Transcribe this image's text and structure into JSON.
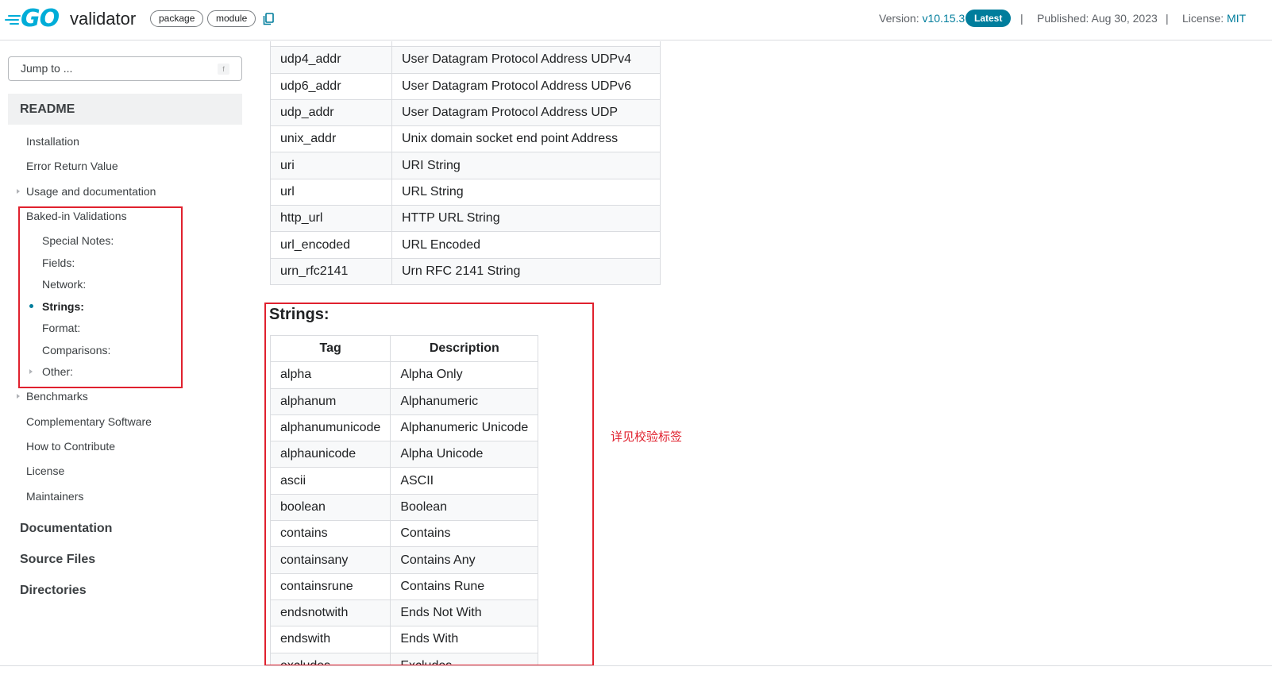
{
  "header": {
    "logo_text": "GO",
    "module_name": "validator",
    "badge_package": "package",
    "badge_module": "module",
    "version_label": "Version: ",
    "version_value": "v10.15.3",
    "latest_label": "Latest",
    "separator": "|",
    "published": "Published: Aug 30, 2023",
    "license_label": "License: ",
    "license_value": "MIT"
  },
  "sidebar": {
    "jump_placeholder": "Jump to ...",
    "jump_key": "f",
    "readme": "README",
    "items": [
      {
        "label": "Installation"
      },
      {
        "label": "Error Return Value"
      },
      {
        "label": "Usage and documentation"
      },
      {
        "label": "Baked-in Validations"
      },
      {
        "label": "Special Notes:"
      },
      {
        "label": "Fields:"
      },
      {
        "label": "Network:"
      },
      {
        "label": "Strings:"
      },
      {
        "label": "Format:"
      },
      {
        "label": "Comparisons:"
      },
      {
        "label": "Other:"
      },
      {
        "label": "Benchmarks"
      },
      {
        "label": "Complementary Software"
      },
      {
        "label": "How to Contribute"
      },
      {
        "label": "License"
      },
      {
        "label": "Maintainers"
      }
    ],
    "sections": {
      "documentation": "Documentation",
      "source_files": "Source Files",
      "directories": "Directories"
    }
  },
  "network_table": {
    "rows": [
      [
        "",
        ""
      ],
      [
        "udp4_addr",
        "User Datagram Protocol Address UDPv4"
      ],
      [
        "udp6_addr",
        "User Datagram Protocol Address UDPv6"
      ],
      [
        "udp_addr",
        "User Datagram Protocol Address UDP"
      ],
      [
        "unix_addr",
        "Unix domain socket end point Address"
      ],
      [
        "uri",
        "URI String"
      ],
      [
        "url",
        "URL String"
      ],
      [
        "http_url",
        "HTTP URL String"
      ],
      [
        "url_encoded",
        "URL Encoded"
      ],
      [
        "urn_rfc2141",
        "Urn RFC 2141 String"
      ]
    ]
  },
  "strings_section": {
    "title": "Strings:",
    "headers": [
      "Tag",
      "Description"
    ],
    "rows": [
      [
        "alpha",
        "Alpha Only"
      ],
      [
        "alphanum",
        "Alphanumeric"
      ],
      [
        "alphanumunicode",
        "Alphanumeric Unicode"
      ],
      [
        "alphaunicode",
        "Alpha Unicode"
      ],
      [
        "ascii",
        "ASCII"
      ],
      [
        "boolean",
        "Boolean"
      ],
      [
        "contains",
        "Contains"
      ],
      [
        "containsany",
        "Contains Any"
      ],
      [
        "containsrune",
        "Contains Rune"
      ],
      [
        "endsnotwith",
        "Ends Not With"
      ],
      [
        "endswith",
        "Ends With"
      ],
      [
        "excludes",
        "Excludes"
      ]
    ]
  },
  "annotation": "详见校验标签",
  "colors": {
    "brand": "#00ADD8",
    "link": "#007d9c",
    "highlight_box": "#e0212e"
  }
}
